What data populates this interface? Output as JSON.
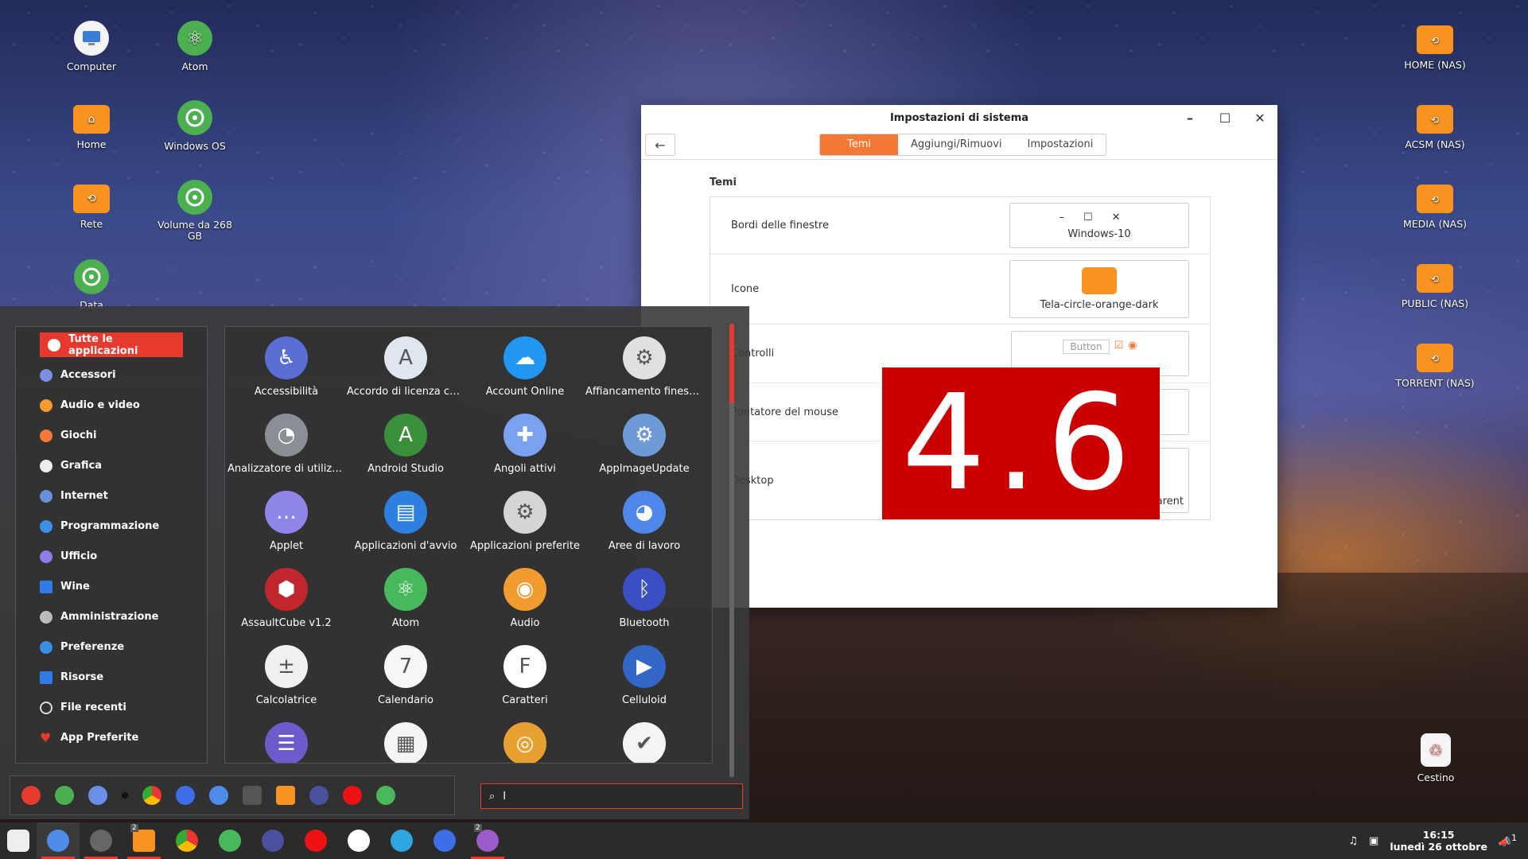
{
  "desktop": {
    "icons_left": [
      {
        "label": "Computer",
        "icon": "computer-icon"
      },
      {
        "label": "Atom",
        "icon": "atom-icon"
      },
      {
        "label": "Home",
        "icon": "home-folder-icon"
      },
      {
        "label": "Windows OS",
        "icon": "drive-icon"
      },
      {
        "label": "Rete",
        "icon": "network-folder-icon"
      },
      {
        "label": "Volume da 268 GB",
        "icon": "drive-icon"
      },
      {
        "label": "Data",
        "icon": "drive-icon"
      }
    ],
    "icons_right": [
      {
        "label": "HOME (NAS)"
      },
      {
        "label": "ACSM (NAS)"
      },
      {
        "label": "MEDIA (NAS)"
      },
      {
        "label": "PUBLIC (NAS)"
      },
      {
        "label": "TORRENT (NAS)"
      }
    ],
    "trash": {
      "label": "Cestino"
    }
  },
  "window": {
    "title": "Impostazioni di sistema",
    "tabs": [
      "Temi",
      "Aggiungi/Rimuovi",
      "Impostazioni"
    ],
    "active_tab": "Temi",
    "section": "Temi",
    "rows": [
      {
        "label": "Bordi delle finestre",
        "value": "Windows-10"
      },
      {
        "label": "Icone",
        "value": "Tela-circle-orange-dark"
      },
      {
        "label": "Controlli",
        "value": "Button"
      },
      {
        "label": "Puntatore del mouse",
        "value": ""
      },
      {
        "label": "Desktop",
        "value": "arent"
      }
    ]
  },
  "overlay": {
    "text": "4.6"
  },
  "menu": {
    "categories": [
      "Tutte le applicazioni",
      "Accessori",
      "Audio e video",
      "Giochi",
      "Grafica",
      "Internet",
      "Programmazione",
      "Ufficio",
      "Wine",
      "Amministrazione",
      "Preferenze",
      "Risorse",
      "File recenti",
      "App Preferite"
    ],
    "apps": [
      {
        "name": "Accessibilità",
        "color": "#5b6ed6",
        "glyph": "♿"
      },
      {
        "name": "Accordo di licenza co...",
        "color": "#dfe6ee",
        "glyph": "A"
      },
      {
        "name": "Account Online",
        "color": "#2196f3",
        "glyph": "☁"
      },
      {
        "name": "Affiancamento finestre",
        "color": "#e0e0e0",
        "glyph": "⚙"
      },
      {
        "name": "Analizzatore di utilizzo...",
        "color": "#8a8f96",
        "glyph": "◔"
      },
      {
        "name": "Android Studio",
        "color": "#3a8f3a",
        "glyph": "A"
      },
      {
        "name": "Angoli attivi",
        "color": "#7ba2f0",
        "glyph": "✚"
      },
      {
        "name": "AppImageUpdate",
        "color": "#6f9ad8",
        "glyph": "⚙"
      },
      {
        "name": "Applet",
        "color": "#8e86e8",
        "glyph": "…"
      },
      {
        "name": "Applicazioni d'avvio",
        "color": "#2d7fe0",
        "glyph": "▤"
      },
      {
        "name": "Applicazioni preferite",
        "color": "#d5d5d5",
        "glyph": "⚙"
      },
      {
        "name": "Aree di lavoro",
        "color": "#4f87ea",
        "glyph": "◕"
      },
      {
        "name": "AssaultCube v1.2",
        "color": "#c0262c",
        "glyph": "⬢"
      },
      {
        "name": "Atom",
        "color": "#48b85c",
        "glyph": "⚛"
      },
      {
        "name": "Audio",
        "color": "#f29b2f",
        "glyph": "◉"
      },
      {
        "name": "Bluetooth",
        "color": "#3a4fc4",
        "glyph": "ᛒ"
      },
      {
        "name": "Calcolatrice",
        "color": "#f0f0f0",
        "glyph": "±"
      },
      {
        "name": "Calendario",
        "color": "#f6f6f6",
        "glyph": "7"
      },
      {
        "name": "Caratteri",
        "color": "#ffffff",
        "glyph": "F"
      },
      {
        "name": "Celluloid",
        "color": "#3466c8",
        "glyph": "▶"
      },
      {
        "name": "",
        "color": "#6d5acb",
        "glyph": "☰"
      },
      {
        "name": "",
        "color": "#f4f4f4",
        "glyph": "▦"
      },
      {
        "name": "",
        "color": "#e8a030",
        "glyph": "◎"
      },
      {
        "name": "",
        "color": "#f4f4f4",
        "glyph": "✔"
      }
    ],
    "search_value": "I"
  },
  "taskbar": {
    "badge_files": "2",
    "badge_last": "2",
    "clock_time": "16:15",
    "clock_date": "lunedì 26 ottobre",
    "notif_count": "1"
  }
}
